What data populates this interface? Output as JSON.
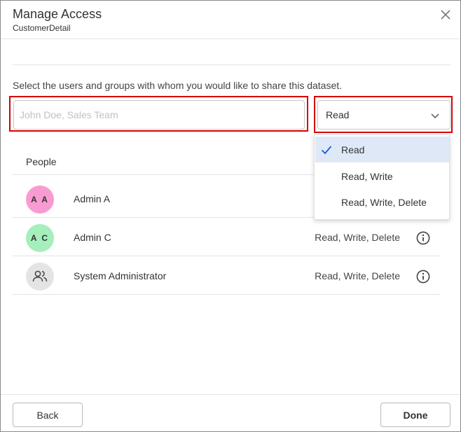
{
  "dialog": {
    "title": "Manage Access",
    "subtitle": "CustomerDetail",
    "instruction": "Select the users and groups with whom you would like to share this dataset."
  },
  "share": {
    "input_placeholder": "John Doe, Sales Team",
    "input_value": "",
    "permission_selected": "Read",
    "permission_options": [
      {
        "label": "Read",
        "selected": true
      },
      {
        "label": "Read, Write",
        "selected": false
      },
      {
        "label": "Read, Write, Delete",
        "selected": false
      }
    ]
  },
  "people": {
    "header": "People",
    "rows": [
      {
        "initials": "A A",
        "name": "Admin A",
        "permission": "",
        "avatar_color": "#f99bd3",
        "icon": "initials"
      },
      {
        "initials": "A C",
        "name": "Admin C",
        "permission": "Read, Write, Delete",
        "avatar_color": "#a6eebb",
        "icon": "initials"
      },
      {
        "initials": "",
        "name": "System Administrator",
        "permission": "Read, Write, Delete",
        "avatar_color": "#e4e4e4",
        "icon": "group-icon"
      }
    ]
  },
  "footer": {
    "back_label": "Back",
    "done_label": "Done"
  },
  "colors": {
    "highlight": "#d60000",
    "selected_option_bg": "#dfe8f7",
    "check_color": "#1a5fd0"
  }
}
